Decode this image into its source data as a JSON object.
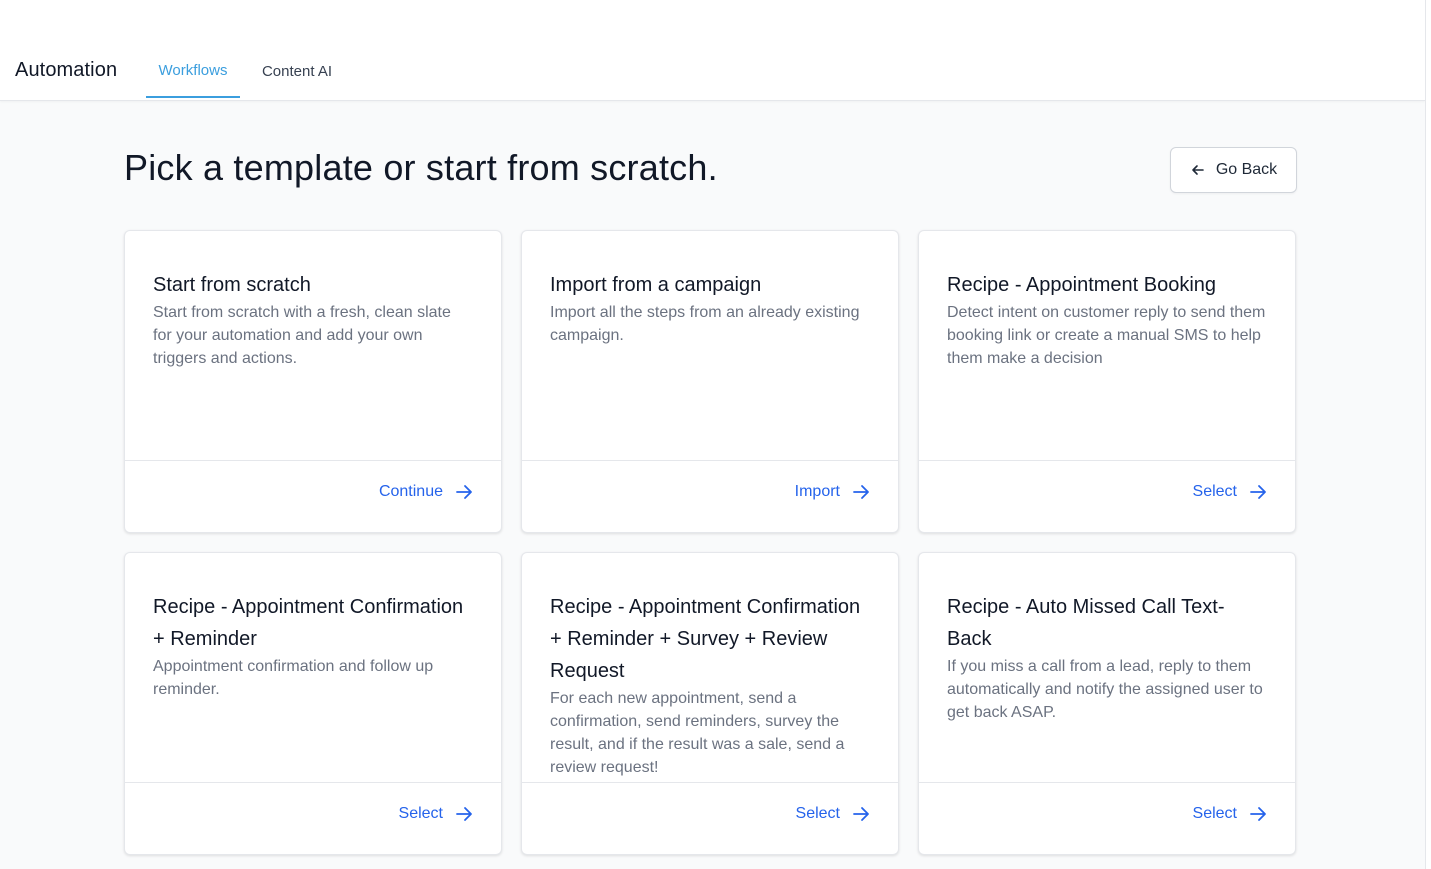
{
  "header": {
    "app_title": "Automation",
    "tabs": [
      {
        "label": "Workflows",
        "active": true
      },
      {
        "label": "Content AI",
        "active": false
      }
    ]
  },
  "page": {
    "title": "Pick a template or start from scratch.",
    "go_back_label": "Go Back"
  },
  "cards": [
    {
      "title": "Start from scratch",
      "description": "Start from scratch with a fresh, clean slate for your automation and add your own triggers and actions.",
      "action": "Continue"
    },
    {
      "title": "Import from a campaign",
      "description": "Import all the steps from an already existing campaign.",
      "action": "Import"
    },
    {
      "title": "Recipe - Appointment Booking",
      "description": "Detect intent on customer reply to send them booking link or create a manual SMS to help them make a decision",
      "action": "Select"
    },
    {
      "title": "Recipe - Appointment Confirmation + Reminder",
      "description": "Appointment confirmation and follow up reminder.",
      "action": "Select"
    },
    {
      "title": "Recipe - Appointment Confirmation + Reminder + Survey + Review Request",
      "description": "For each new appointment, send a confirmation, send reminders, survey the result, and if the result was a sale, send a review request!",
      "action": "Select"
    },
    {
      "title": "Recipe - Auto Missed Call Text-Back",
      "description": "If you miss a call from a lead, reply to them automatically and notify the assigned user to get back ASAP.",
      "action": "Select"
    }
  ],
  "colors": {
    "accent_tab": "#3b9ede",
    "action_link": "#2563eb",
    "background": "#f9fafb"
  }
}
